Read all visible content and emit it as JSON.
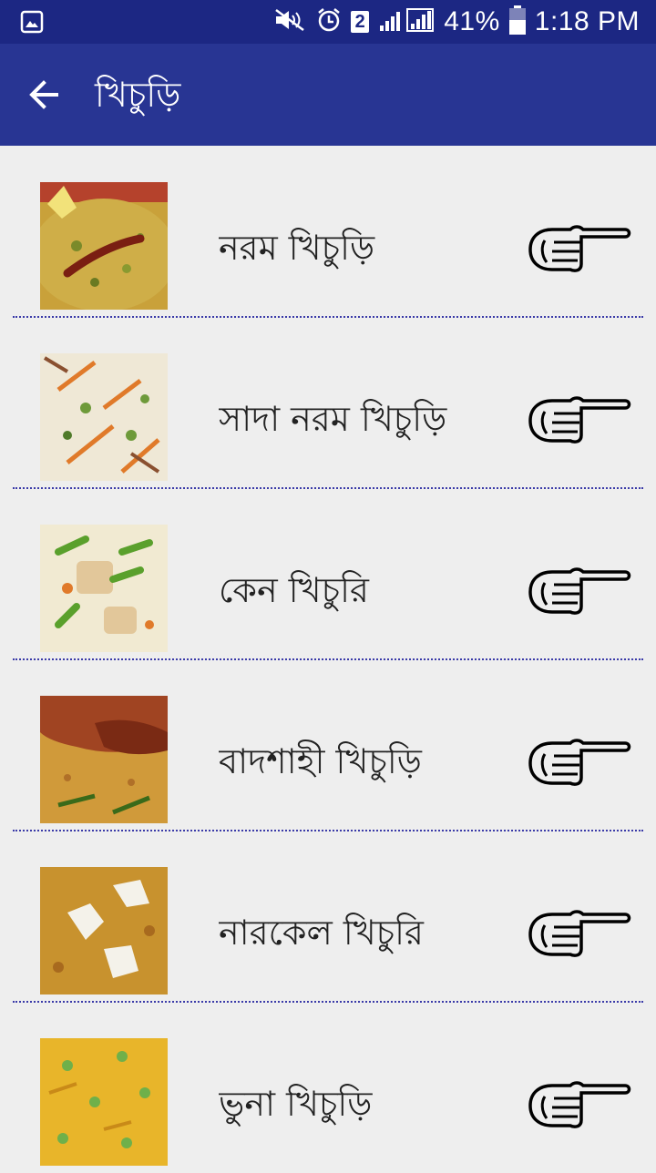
{
  "status_bar": {
    "sim": "2",
    "battery": "41%",
    "time": "1:18 PM"
  },
  "app_bar": {
    "title": "খিচুড়ি",
    "back_icon": "arrow-left-icon"
  },
  "items": [
    {
      "label": "নরম খিচুড়ি",
      "icon": "pointing-hand-icon",
      "image": "khichuri-photo"
    },
    {
      "label": "সাদা নরম খিচুড়ি",
      "icon": "pointing-hand-icon",
      "image": "white-khichuri-photo"
    },
    {
      "label": "কেন খিচুরি",
      "icon": "pointing-hand-icon",
      "image": "vegetable-khichuri-photo"
    },
    {
      "label": "বাদশাহী খিচুড়ি",
      "icon": "pointing-hand-icon",
      "image": "badshahi-khichuri-photo"
    },
    {
      "label": "নারকেল খিচুরি",
      "icon": "pointing-hand-icon",
      "image": "coconut-khichuri-photo"
    },
    {
      "label": "ভুনা খিচুড়ি",
      "icon": "pointing-hand-icon",
      "image": "bhuna-khichuri-photo"
    }
  ],
  "colors": {
    "status_bar": "#1c2783",
    "app_bar": "#283593",
    "background": "#eeeeee",
    "divider": "#3a3aa8"
  }
}
